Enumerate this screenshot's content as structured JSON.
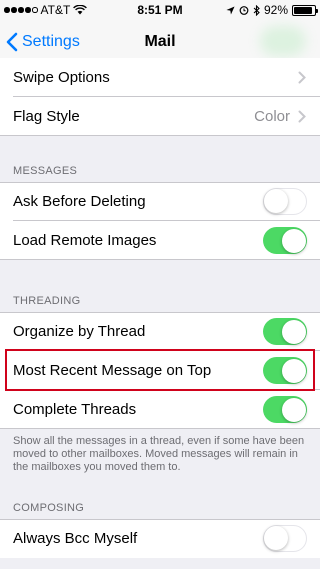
{
  "status_bar": {
    "carrier": "AT&T",
    "time": "8:51 PM",
    "battery": "92%",
    "battery_level": 0.92,
    "signal_bars": 4,
    "signal_total": 5
  },
  "nav": {
    "back_label": "Settings",
    "title": "Mail"
  },
  "top_rows": {
    "swipe_options": "Swipe Options",
    "flag_style": "Flag Style",
    "flag_style_value": "Color"
  },
  "messages": {
    "header": "MESSAGES",
    "ask_before_deleting": "Ask Before Deleting",
    "ask_before_deleting_on": false,
    "load_remote_images": "Load Remote Images",
    "load_remote_images_on": true
  },
  "threading": {
    "header": "THREADING",
    "organize_by_thread": "Organize by Thread",
    "organize_by_thread_on": true,
    "most_recent_on_top": "Most Recent Message on Top",
    "most_recent_on_top_on": true,
    "complete_threads": "Complete Threads",
    "complete_threads_on": true,
    "footer": "Show all the messages in a thread, even if some have been moved to other mailboxes. Moved messages will remain in the mailboxes you moved them to."
  },
  "composing": {
    "header": "COMPOSING",
    "always_bcc_myself": "Always Bcc Myself",
    "always_bcc_myself_on": false
  },
  "colors": {
    "accent": "#007aff",
    "toggle_on": "#4cd964",
    "highlight": "#d0021b"
  }
}
